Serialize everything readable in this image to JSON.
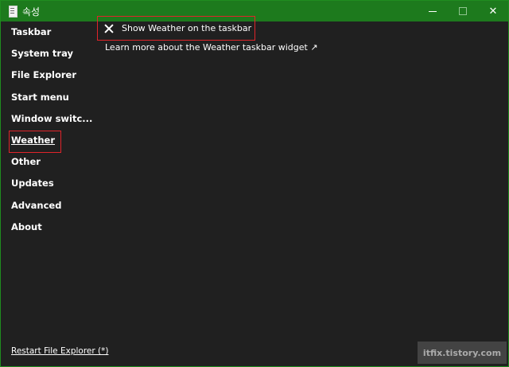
{
  "window": {
    "title": "속성",
    "controls": {
      "minimize": "minimize",
      "maximize": "maximize",
      "close": "✕"
    }
  },
  "sidebar": {
    "items": [
      {
        "label": "Taskbar"
      },
      {
        "label": "System tray"
      },
      {
        "label": "File Explorer"
      },
      {
        "label": "Start menu"
      },
      {
        "label": "Window switc..."
      },
      {
        "label": "Weather"
      },
      {
        "label": "Other"
      },
      {
        "label": "Updates"
      },
      {
        "label": "Advanced"
      },
      {
        "label": "About"
      }
    ],
    "active": "Weather",
    "restart_link": "Restart File Explorer (*)"
  },
  "content": {
    "option_label": "Show Weather on the taskbar",
    "option_icon": "x-icon",
    "learn_more": "Learn more about the Weather taskbar widget ↗"
  },
  "watermark": "itfix.tistory.com",
  "colors": {
    "titlebar": "#1d7a1d",
    "window_bg": "#202020",
    "highlight_border": "#e0242a"
  }
}
